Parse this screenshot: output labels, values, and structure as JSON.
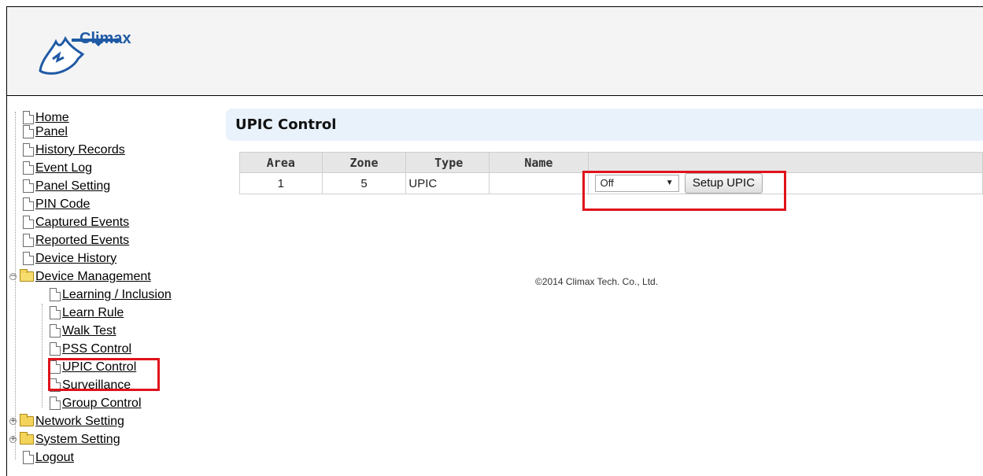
{
  "header": {
    "logo_text": "Climax"
  },
  "sidebar": {
    "items": [
      {
        "label": "Home"
      },
      {
        "label": "Panel"
      },
      {
        "label": "History Records"
      },
      {
        "label": "Event Log"
      },
      {
        "label": "Panel Setting"
      },
      {
        "label": "PIN Code"
      },
      {
        "label": "Captured Events"
      },
      {
        "label": "Reported Events"
      },
      {
        "label": "Device History"
      },
      {
        "label": "Device Management",
        "children": [
          {
            "label": "Learning / Inclusion"
          },
          {
            "label": "Learn Rule"
          },
          {
            "label": "Walk Test"
          },
          {
            "label": "PSS Control"
          },
          {
            "label": "UPIC Control"
          },
          {
            "label": "Surveillance"
          },
          {
            "label": "Group Control"
          }
        ]
      },
      {
        "label": "Network Setting"
      },
      {
        "label": "System Setting"
      },
      {
        "label": "Logout"
      }
    ]
  },
  "main": {
    "title": "UPIC Control",
    "table": {
      "headers": [
        "Area",
        "Zone",
        "Type",
        "Name",
        ""
      ],
      "rows": [
        {
          "area": "1",
          "zone": "5",
          "type": "UPIC",
          "name": "",
          "state": "Off",
          "button": "Setup UPIC"
        }
      ]
    }
  },
  "footer": {
    "copyright": "©2014 Climax Tech. Co., Ltd."
  },
  "colors": {
    "accent": "#1f5aa6",
    "highlight": "#e0121b",
    "title_bg": "#e9f1fb"
  }
}
